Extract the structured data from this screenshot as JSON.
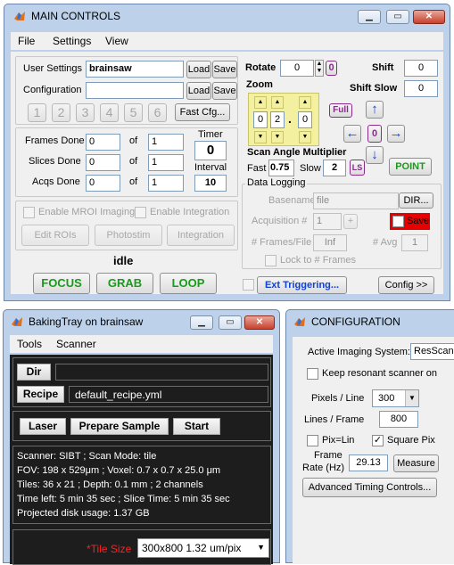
{
  "main_controls": {
    "title": "MAIN CONTROLS",
    "menu": [
      "File",
      "Settings",
      "View"
    ],
    "user_settings_label": "User Settings",
    "user_settings_value": "brainsaw",
    "configuration_label": "Configuration",
    "configuration_value": "",
    "load_label": "Load",
    "save_label": "Save",
    "config_slots": [
      "1",
      "2",
      "3",
      "4",
      "5",
      "6"
    ],
    "fast_cfg_label": "Fast Cfg...",
    "frames_done_label": "Frames Done",
    "slices_done_label": "Slices Done",
    "acqs_done_label": "Acqs Done",
    "of_label": "of",
    "frames_done": "0",
    "frames_total": "1",
    "slices_done": "0",
    "slices_total": "1",
    "acqs_done": "0",
    "acqs_total": "1",
    "timer_label": "Timer",
    "timer_value": "0",
    "interval_label": "Interval",
    "interval_value": "10",
    "enable_mroi_label": "Enable MROI Imaging",
    "enable_integration_label": "Enable Integration",
    "edit_rois_label": "Edit ROIs",
    "photostim_label": "Photostim",
    "integration_label": "Integration",
    "status": "idle",
    "focus_label": "FOCUS",
    "grab_label": "GRAB",
    "loop_label": "LOOP",
    "rotate_label": "Rotate",
    "rotate_value": "0",
    "rotate_zero": "0",
    "shift_label": "Shift",
    "shift_value": "0",
    "shift_slow_label": "Shift Slow",
    "shift_slow_value": "0",
    "zoom_label": "Zoom",
    "zoom_digits": [
      "0",
      "2",
      "0"
    ],
    "zoom_dot": ".",
    "full_label": "Full",
    "center_label": "0",
    "scan_angle_label": "Scan Angle Multiplier",
    "fast_label": "Fast",
    "fast_value": "0.75",
    "slow_label": "Slow",
    "slow_value": "2",
    "ls_label": "LS",
    "point_label": "POINT",
    "data_logging_label": "Data Logging",
    "basename_label": "Basename",
    "basename_value": "file",
    "dir_label": "DIR...",
    "acquisition_label": "Acquisition #",
    "acquisition_value": "1",
    "plus_label": "+",
    "save_chk_label": "Save",
    "frames_file_label": "# Frames/File",
    "frames_file_value": "Inf",
    "avg_label": "# Avg",
    "avg_value": "1",
    "lock_frames_label": "Lock to # Frames",
    "ext_trigger_label": "Ext Triggering...",
    "config_btn_label": "Config >>",
    "accent_blue": "#1242d0",
    "accent_green": "#1a9a1a"
  },
  "bakingtray": {
    "title": "BakingTray on brainsaw",
    "menu": [
      "Tools",
      "Scanner"
    ],
    "dir_label": "Dir",
    "dir_value": "",
    "recipe_label": "Recipe",
    "recipe_value": "default_recipe.yml",
    "laser_label": "Laser",
    "prepare_label": "Prepare Sample",
    "start_label": "Start",
    "info_lines": [
      "Scanner: SIBT ; Scan Mode: tile",
      "FOV: 198 x 529μm ; Voxel: 0.7 x 0.7 x 25.0 μm",
      "Tiles: 36 x 21 ; Depth: 0.1 mm ; 2 channels",
      "Time left: 5 min 35 sec ; Slice Time: 5 min 35 sec",
      "Projected disk usage: 1.37 GB"
    ],
    "tile_size_label": "*Tile Size",
    "tile_size_value": "300x800 1.32 um/pix"
  },
  "configuration": {
    "title": "CONFIGURATION",
    "active_system_label": "Active Imaging System:",
    "active_system_value": "ResScann",
    "keep_resonant_label": "Keep resonant scanner on",
    "pixels_line_label": "Pixels / Line",
    "pixels_line_value": "300",
    "lines_frame_label": "Lines / Frame",
    "lines_frame_value": "800",
    "pix_lin_label": "Pix=Lin",
    "square_pix_label": "Square Pix",
    "square_pix_checked": "✓",
    "frame_rate_label_1": "Frame",
    "frame_rate_label_2": "Rate (Hz)",
    "frame_rate_value": "29.13",
    "measure_label": "Measure",
    "advanced_timing_label": "Advanced Timing Controls..."
  }
}
